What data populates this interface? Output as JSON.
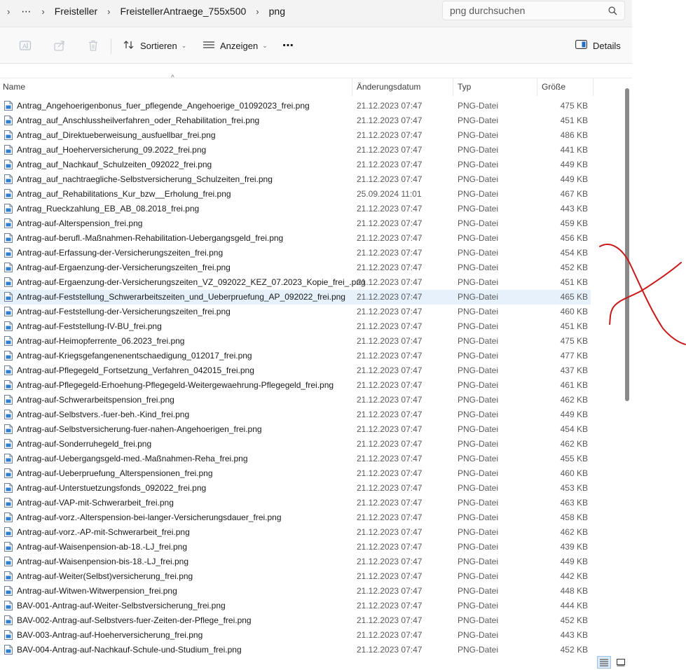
{
  "breadcrumb": {
    "overflow": "⋯",
    "items": [
      "Freisteller",
      "FreistellerAntraege_755x500",
      "png"
    ]
  },
  "search": {
    "placeholder": "png durchsuchen"
  },
  "toolbar": {
    "sort_label": "Sortieren",
    "view_label": "Anzeigen",
    "more_label": "⋯",
    "details_label": "Details"
  },
  "columns": {
    "name": "Name",
    "date": "Änderungsdatum",
    "type": "Typ",
    "size": "Größe"
  },
  "accent_color": "#0067c0",
  "annotation_color": "#c81a1a",
  "selected_row": 13,
  "files": [
    {
      "name": "Antrag_Angehoerigenbonus_fuer_pflegende_Angehoerige_01092023_frei.png",
      "date": "21.12.2023 07:47",
      "type": "PNG-Datei",
      "size": "475 KB"
    },
    {
      "name": "Antrag_auf_Anschlussheilverfahren_oder_Rehabilitation_frei.png",
      "date": "21.12.2023 07:47",
      "type": "PNG-Datei",
      "size": "451 KB"
    },
    {
      "name": "Antrag_auf_Direktueberweisung_ausfuellbar_frei.png",
      "date": "21.12.2023 07:47",
      "type": "PNG-Datei",
      "size": "486 KB"
    },
    {
      "name": "Antrag_auf_Hoeherversicherung_09.2022_frei.png",
      "date": "21.12.2023 07:47",
      "type": "PNG-Datei",
      "size": "441 KB"
    },
    {
      "name": "Antrag_auf_Nachkauf_Schulzeiten_092022_frei.png",
      "date": "21.12.2023 07:47",
      "type": "PNG-Datei",
      "size": "449 KB"
    },
    {
      "name": "Antrag_auf_nachtraegliche-Selbstversicherung_Schulzeiten_frei.png",
      "date": "21.12.2023 07:47",
      "type": "PNG-Datei",
      "size": "449 KB"
    },
    {
      "name": "Antrag_auf_Rehabilitations_Kur_bzw__Erholung_frei.png",
      "date": "25.09.2024 11:01",
      "type": "PNG-Datei",
      "size": "467 KB"
    },
    {
      "name": "Antrag_Rueckzahlung_EB_AB_08.2018_frei.png",
      "date": "21.12.2023 07:47",
      "type": "PNG-Datei",
      "size": "443 KB"
    },
    {
      "name": "Antrag-auf-Alterspension_frei.png",
      "date": "21.12.2023 07:47",
      "type": "PNG-Datei",
      "size": "459 KB"
    },
    {
      "name": "Antrag-auf-berufl.-Maßnahmen-Rehabilitation-Uebergangsgeld_frei.png",
      "date": "21.12.2023 07:47",
      "type": "PNG-Datei",
      "size": "456 KB"
    },
    {
      "name": "Antrag-auf-Erfassung-der-Versicherungszeiten_frei.png",
      "date": "21.12.2023 07:47",
      "type": "PNG-Datei",
      "size": "454 KB"
    },
    {
      "name": "Antrag-auf-Ergaenzung-der-Versicherungszeiten_frei.png",
      "date": "21.12.2023 07:47",
      "type": "PNG-Datei",
      "size": "452 KB"
    },
    {
      "name": "Antrag-auf-Ergaenzung-der-Versicherungszeiten_VZ_092022_KEZ_07.2023_Kopie_frei_.png",
      "date": "21.12.2023 07:47",
      "type": "PNG-Datei",
      "size": "451 KB"
    },
    {
      "name": "Antrag-auf-Feststellung_Schwerarbeitszeiten_und_Ueberpruefung_AP_092022_frei.png",
      "date": "21.12.2023 07:47",
      "type": "PNG-Datei",
      "size": "465 KB"
    },
    {
      "name": "Antrag-auf-Feststellung-der-Versicherungszeiten_frei.png",
      "date": "21.12.2023 07:47",
      "type": "PNG-Datei",
      "size": "460 KB"
    },
    {
      "name": "Antrag-auf-Feststellung-IV-BU_frei.png",
      "date": "21.12.2023 07:47",
      "type": "PNG-Datei",
      "size": "451 KB"
    },
    {
      "name": "Antrag-auf-Heimopferrente_06.2023_frei.png",
      "date": "21.12.2023 07:47",
      "type": "PNG-Datei",
      "size": "475 KB"
    },
    {
      "name": "Antrag-auf-Kriegsgefangenenentschaedigung_012017_frei.png",
      "date": "21.12.2023 07:47",
      "type": "PNG-Datei",
      "size": "477 KB"
    },
    {
      "name": "Antrag-auf-Pflegegeld_Fortsetzung_Verfahren_042015_frei.png",
      "date": "21.12.2023 07:47",
      "type": "PNG-Datei",
      "size": "437 KB"
    },
    {
      "name": "Antrag-auf-Pflegegeld-Erhoehung-Pflegegeld-Weitergewaehrung-Pflegegeld_frei.png",
      "date": "21.12.2023 07:47",
      "type": "PNG-Datei",
      "size": "461 KB"
    },
    {
      "name": "Antrag-auf-Schwerarbeitspension_frei.png",
      "date": "21.12.2023 07:47",
      "type": "PNG-Datei",
      "size": "462 KB"
    },
    {
      "name": "Antrag-auf-Selbstvers.-fuer-beh.-Kind_frei.png",
      "date": "21.12.2023 07:47",
      "type": "PNG-Datei",
      "size": "449 KB"
    },
    {
      "name": "Antrag-auf-Selbstversicherung-fuer-nahen-Angehoerigen_frei.png",
      "date": "21.12.2023 07:47",
      "type": "PNG-Datei",
      "size": "454 KB"
    },
    {
      "name": "Antrag-auf-Sonderruhegeld_frei.png",
      "date": "21.12.2023 07:47",
      "type": "PNG-Datei",
      "size": "462 KB"
    },
    {
      "name": "Antrag-auf-Uebergangsgeld-med.-Maßnahmen-Reha_frei.png",
      "date": "21.12.2023 07:47",
      "type": "PNG-Datei",
      "size": "455 KB"
    },
    {
      "name": "Antrag-auf-Ueberpruefung_Alterspensionen_frei.png",
      "date": "21.12.2023 07:47",
      "type": "PNG-Datei",
      "size": "460 KB"
    },
    {
      "name": "Antrag-auf-Unterstuetzungsfonds_092022_frei.png",
      "date": "21.12.2023 07:47",
      "type": "PNG-Datei",
      "size": "453 KB"
    },
    {
      "name": "Antrag-auf-VAP-mit-Schwerarbeit_frei.png",
      "date": "21.12.2023 07:47",
      "type": "PNG-Datei",
      "size": "463 KB"
    },
    {
      "name": "Antrag-auf-vorz.-Alterspension-bei-langer-Versicherungsdauer_frei.png",
      "date": "21.12.2023 07:47",
      "type": "PNG-Datei",
      "size": "458 KB"
    },
    {
      "name": "Antrag-auf-vorz.-AP-mit-Schwerarbeit_frei.png",
      "date": "21.12.2023 07:47",
      "type": "PNG-Datei",
      "size": "462 KB"
    },
    {
      "name": "Antrag-auf-Waisenpension-ab-18.-LJ_frei.png",
      "date": "21.12.2023 07:47",
      "type": "PNG-Datei",
      "size": "439 KB"
    },
    {
      "name": "Antrag-auf-Waisenpension-bis-18.-LJ_frei.png",
      "date": "21.12.2023 07:47",
      "type": "PNG-Datei",
      "size": "449 KB"
    },
    {
      "name": "Antrag-auf-Weiter(Selbst)versicherung_frei.png",
      "date": "21.12.2023 07:47",
      "type": "PNG-Datei",
      "size": "442 KB"
    },
    {
      "name": "Antrag-auf-Witwen-Witwerpension_frei.png",
      "date": "21.12.2023 07:47",
      "type": "PNG-Datei",
      "size": "448 KB"
    },
    {
      "name": "BAV-001-Antrag-auf-Weiter-Selbstversicherung_frei.png",
      "date": "21.12.2023 07:47",
      "type": "PNG-Datei",
      "size": "444 KB"
    },
    {
      "name": "BAV-002-Antrag-auf-Selbstvers-fuer-Zeiten-der-Pflege_frei.png",
      "date": "21.12.2023 07:47",
      "type": "PNG-Datei",
      "size": "452 KB"
    },
    {
      "name": "BAV-003-Antrag-auf-Hoeherversicherung_frei.png",
      "date": "21.12.2023 07:47",
      "type": "PNG-Datei",
      "size": "443 KB"
    },
    {
      "name": "BAV-004-Antrag-auf-Nachkauf-Schule-und-Studium_frei.png",
      "date": "21.12.2023 07:47",
      "type": "PNG-Datei",
      "size": "452 KB"
    }
  ]
}
